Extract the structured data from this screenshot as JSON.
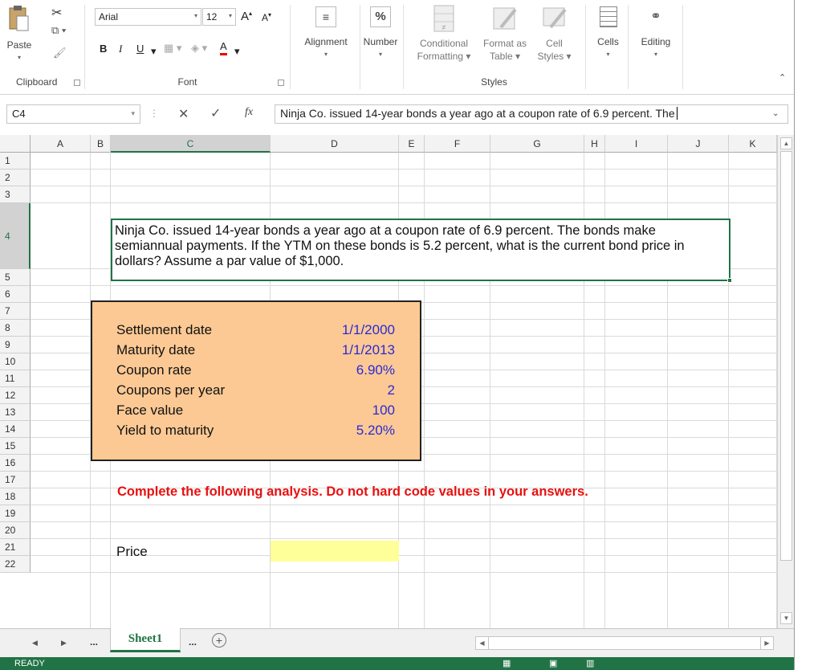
{
  "ribbon": {
    "clipboard": {
      "paste": "Paste",
      "group": "Clipboard"
    },
    "font": {
      "name": "Arial",
      "size": "12",
      "group": "Font",
      "bold": "B",
      "italic": "I",
      "underline": "U",
      "grow": "A",
      "shrink": "A",
      "font_color": "A"
    },
    "alignment": {
      "label": "Alignment"
    },
    "number": {
      "label": "Number",
      "symbol": "%"
    },
    "styles": {
      "conditional": "Conditional",
      "conditional2": "Formatting",
      "format_as": "Format as",
      "format_as2": "Table",
      "cell": "Cell",
      "cell2": "Styles",
      "group": "Styles"
    },
    "cells": {
      "label": "Cells"
    },
    "editing": {
      "label": "Editing"
    }
  },
  "formula_bar": {
    "name_box": "C4",
    "fx": "fx",
    "content": "Ninja Co. issued 14-year bonds a year ago at a coupon rate of 6.9 percent. The"
  },
  "columns": [
    "A",
    "B",
    "C",
    "D",
    "E",
    "F",
    "G",
    "H",
    "I",
    "J",
    "K"
  ],
  "rows": [
    "1",
    "2",
    "3",
    "4",
    "5",
    "6",
    "7",
    "8",
    "9",
    "10",
    "11",
    "12",
    "13",
    "14",
    "15",
    "16",
    "17",
    "18",
    "19",
    "20",
    "21",
    "22"
  ],
  "sheet": {
    "question": "Ninja Co. issued 14-year bonds a year ago at a coupon rate of 6.9 percent. The bonds make semiannual payments. If the YTM on these bonds is 5.2 percent, what is the current bond price in dollars? Assume a par value of $1,000.",
    "inputs": [
      {
        "label": "Settlement date",
        "value": "1/1/2000"
      },
      {
        "label": "Maturity date",
        "value": "1/1/2013"
      },
      {
        "label": "Coupon rate",
        "value": "6.90%"
      },
      {
        "label": "Coupons per year",
        "value": "2"
      },
      {
        "label": "Face value",
        "value": "100"
      },
      {
        "label": "Yield to maturity",
        "value": "5.20%"
      }
    ],
    "instruction": "Complete the following analysis. Do not hard code values in your answers.",
    "price_label": "Price"
  },
  "tabs": {
    "ellipsis_left": "...",
    "active": "Sheet1",
    "ellipsis_right": "..."
  },
  "status": {
    "mode": "READY"
  },
  "colors": {
    "excel_green": "#217346",
    "input_box": "#fcc994",
    "input_value": "#2a2ad4",
    "instruction": "#e81010",
    "answer_cell": "#ffff99"
  }
}
